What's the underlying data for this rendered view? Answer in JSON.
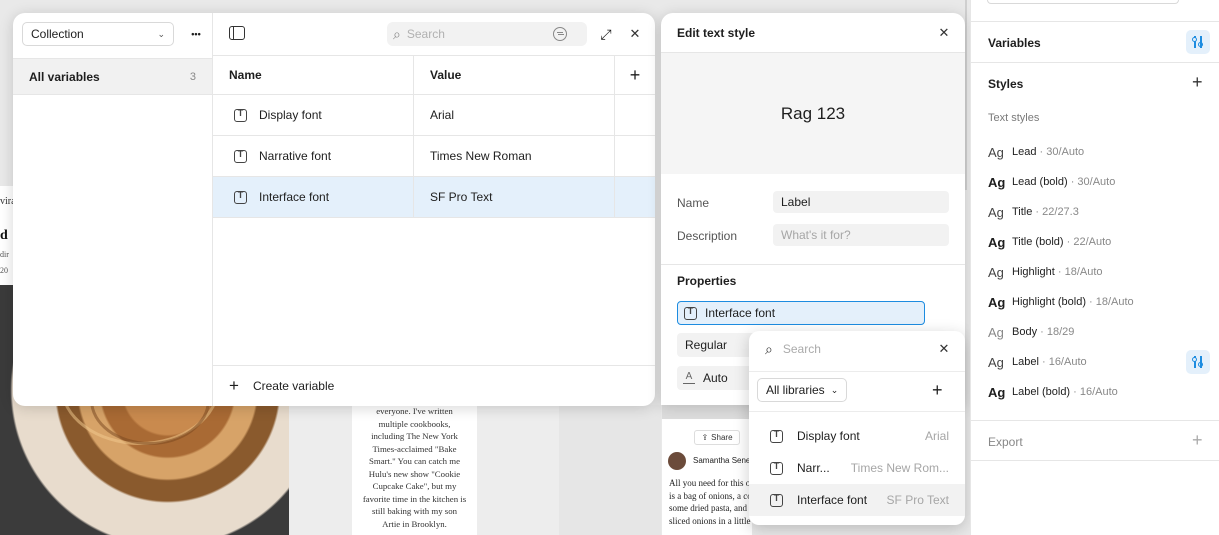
{
  "canvas": {
    "left_snippet": {
      "line1": "vira",
      "line2": "d",
      "line3": "dir",
      "line4": "20"
    },
    "article_lines": [
      "everyone. I've written",
      "multiple cookbooks,",
      "including The New York",
      "Times-acclaimed \"Bake",
      "Smart.\" You can catch me",
      "Hulu's new show \"Cookie",
      "Cupcake Cake\", but my",
      "favorite time in the kitchen is",
      "still baking with my son",
      "Artie in Brooklyn."
    ],
    "mobile": {
      "share_label": "Share",
      "author": "Samantha Senev",
      "body_lines": [
        "All you need for this o",
        "is a bag of onions, a co",
        "some dried pasta, and",
        "sliced onions in a little butter and olive oil"
      ]
    }
  },
  "variables_modal": {
    "collection_select": "Collection",
    "sidebar": {
      "all_variables_label": "All variables",
      "all_variables_count": "3"
    },
    "search_placeholder": "Search",
    "columns": {
      "name": "Name",
      "value": "Value"
    },
    "rows": [
      {
        "name": "Display font",
        "value": "Arial",
        "selected": false
      },
      {
        "name": "Narrative font",
        "value": "Times New Roman",
        "selected": false
      },
      {
        "name": "Interface font",
        "value": "SF Pro Text",
        "selected": true
      }
    ],
    "create_label": "Create variable"
  },
  "edit_text_style": {
    "title": "Edit text style",
    "preview_text": "Rag 123",
    "name_label": "Name",
    "name_value": "Label",
    "description_label": "Description",
    "description_placeholder": "What's it for?",
    "properties_label": "Properties",
    "font_family": "Interface font",
    "font_weight": "Regular",
    "line_height": "Auto"
  },
  "library_dropdown": {
    "search_placeholder": "Search",
    "filter_label": "All libraries",
    "items": [
      {
        "name": "Display font",
        "value": "Arial"
      },
      {
        "name": "Narr...",
        "value": "Times New Rom..."
      },
      {
        "name": "Interface font",
        "value": "SF Pro Text"
      }
    ]
  },
  "right_panel": {
    "variables_label": "Variables",
    "styles_label": "Styles",
    "text_styles_label": "Text styles",
    "styles": [
      {
        "name": "Lead",
        "meta": " · 30/Auto",
        "weight": "regular"
      },
      {
        "name": "Lead (bold)",
        "meta": " · 30/Auto",
        "weight": "bold"
      },
      {
        "name": "Title",
        "meta": " · 22/27.3",
        "weight": "regular"
      },
      {
        "name": "Title (bold)",
        "meta": " · 22/Auto",
        "weight": "bold"
      },
      {
        "name": "Highlight",
        "meta": " · 18/Auto",
        "weight": "regular"
      },
      {
        "name": "Highlight (bold)",
        "meta": " · 18/Auto",
        "weight": "bold"
      },
      {
        "name": "Body",
        "meta": " · 18/29",
        "weight": "light"
      },
      {
        "name": "Label",
        "meta": " · 16/Auto",
        "weight": "regular"
      },
      {
        "name": "Label (bold)",
        "meta": " · 16/Auto",
        "weight": "bold"
      }
    ],
    "export_label": "Export"
  },
  "icons": {
    "glyph_text": "Ag",
    "more": "•••",
    "chevron": "⌄",
    "close": "✕",
    "plus": "+",
    "expand": "⤢",
    "search": "⌕"
  },
  "colors": {
    "accent": "#1d8ce0",
    "selection": "#e4f0fb",
    "panel_bg": "#ffffff",
    "canvas_bg": "#e9e9e9"
  }
}
